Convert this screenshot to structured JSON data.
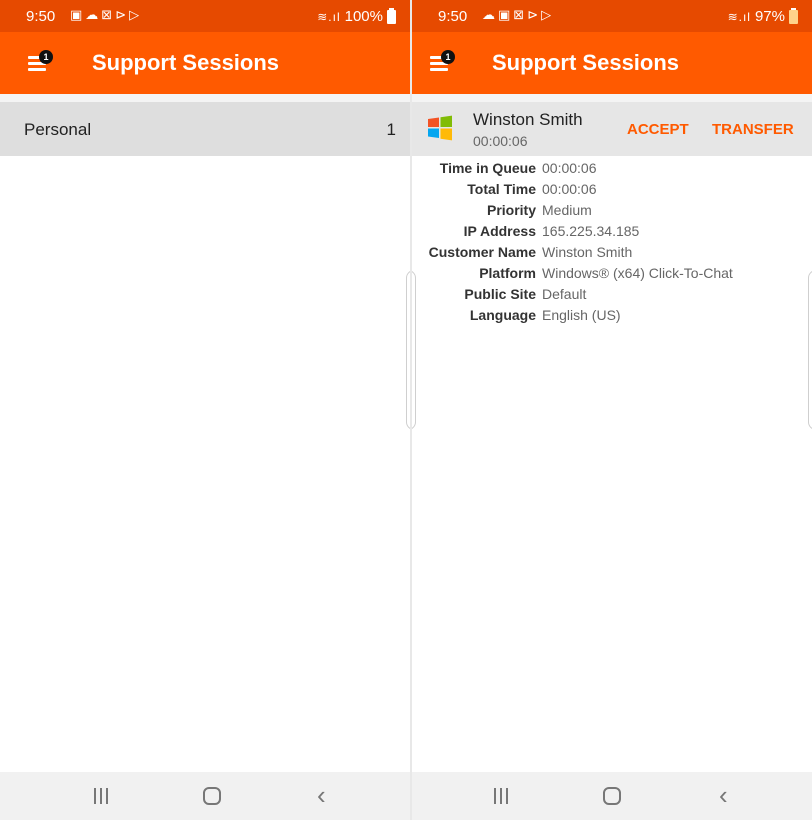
{
  "left_screen": {
    "status_bar": {
      "time": "9:50",
      "notification_icons": [
        "image-icon",
        "cloud-icon",
        "close-box-icon",
        "play-store-icon",
        "play-icon"
      ],
      "battery": "100%"
    },
    "app_bar": {
      "title": "Support Sessions",
      "badge": "1"
    },
    "queues": [
      {
        "label": "Personal",
        "count": "1"
      }
    ],
    "nav_bar": [
      "recents-icon",
      "home-icon",
      "back-icon"
    ]
  },
  "right_screen": {
    "status_bar": {
      "time": "9:50",
      "notification_icons": [
        "cloud-icon",
        "image-icon",
        "close-box-icon",
        "play-store-icon",
        "play-icon"
      ],
      "battery": "97%"
    },
    "app_bar": {
      "title": "Support Sessions",
      "badge": "1"
    },
    "session": {
      "name": "Winston Smith",
      "elapsed": "00:00:06",
      "accept_label": "ACCEPT",
      "transfer_label": "TRANSFER",
      "logo_icon": "windows-logo-icon"
    },
    "details": [
      {
        "label": "Time in Queue",
        "value": "00:00:06"
      },
      {
        "label": "Total Time",
        "value": "00:00:06"
      },
      {
        "label": "Priority",
        "value": "Medium"
      },
      {
        "label": "IP Address",
        "value": "165.225.34.185"
      },
      {
        "label": "Customer Name",
        "value": "Winston Smith"
      },
      {
        "label": "Platform",
        "value": "Windows® (x64) Click-To-Chat"
      },
      {
        "label": "Public Site",
        "value": "Default"
      },
      {
        "label": "Language",
        "value": "English (US)"
      }
    ],
    "nav_bar": [
      "recents-icon",
      "home-icon",
      "back-icon"
    ]
  },
  "colors": {
    "status_bar": "#e64a00",
    "app_bar": "#ff5a00",
    "accent": "#ff5a00",
    "selected_row": "#dedede",
    "nav_bar": "#f1f1f1"
  }
}
